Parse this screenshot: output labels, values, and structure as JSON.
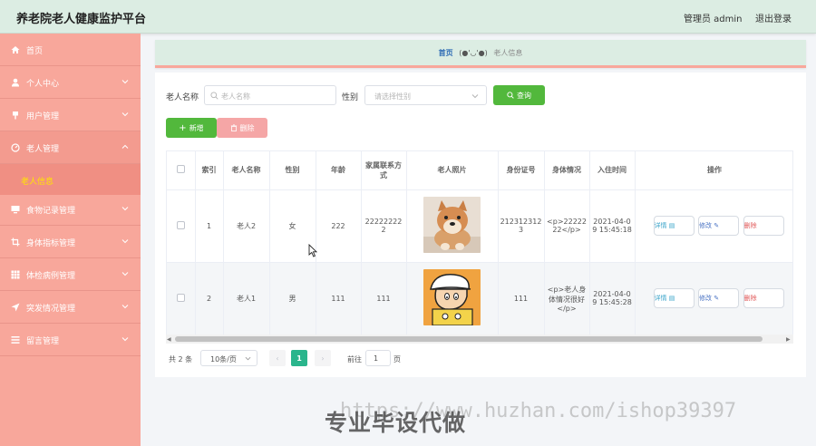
{
  "app": {
    "title": "养老院老人健康监护平台",
    "user_label": "管理员 admin",
    "logout_label": "退出登录"
  },
  "sidebar": {
    "items": [
      {
        "label": "首页",
        "icon": "home-icon"
      },
      {
        "label": "个人中心",
        "icon": "user-icon"
      },
      {
        "label": "用户管理",
        "icon": "pin-icon"
      },
      {
        "label": "老人管理",
        "icon": "dashboard-icon"
      },
      {
        "label": "食物记录管理",
        "icon": "monitor-icon"
      },
      {
        "label": "身体指标管理",
        "icon": "crop-icon"
      },
      {
        "label": "体检病例管理",
        "icon": "grid-icon"
      },
      {
        "label": "突发情况管理",
        "icon": "send-icon"
      },
      {
        "label": "留言管理",
        "icon": "list-icon"
      }
    ],
    "sub_item": "老人信息"
  },
  "breadcrumb": {
    "home": "首页",
    "face": "(●'◡'●)",
    "current": "老人信息"
  },
  "search": {
    "name_label": "老人名称",
    "name_placeholder": "老人名称",
    "gender_label": "性别",
    "gender_placeholder": "请选择性别",
    "query_label": "查询"
  },
  "actions": {
    "add_label": "新增",
    "delete_label": "删除"
  },
  "table": {
    "headers": [
      "索引",
      "老人名称",
      "性别",
      "年龄",
      "家属联系方式",
      "老人照片",
      "身份证号",
      "身体情况",
      "入住时间",
      "操作"
    ],
    "rows": [
      {
        "index": "1",
        "name": "老人2",
        "gender": "女",
        "age": "222",
        "contact": "222222222",
        "photo": "shiba-dog-photo",
        "id_number": "2123123123",
        "health": "<p>2222222</p>",
        "checkin": "2021-04-09 15:45:18"
      },
      {
        "index": "2",
        "name": "老人1",
        "gender": "男",
        "age": "111",
        "contact": "111",
        "photo": "cartoon-boy-photo",
        "id_number": "111",
        "health": "<p>老人身体情况很好</p>",
        "checkin": "2021-04-09 15:45:28"
      }
    ],
    "detail_label": "详情",
    "edit_label": "修改",
    "delete_label": "删除"
  },
  "pagination": {
    "total_text": "共 2 条",
    "page_size": "10条/页",
    "current_page": "1",
    "goto_label": "前往",
    "goto_value": "1",
    "page_suffix": "页"
  },
  "watermark": {
    "cn": "专业毕设代做",
    "url": "https://www.huzhan.com/ishop39397"
  },
  "colors": {
    "sidebar": "#f8a79b",
    "header": "#dcede3",
    "primary_green": "#52b83c",
    "active_page": "#2ab58c",
    "sub_item_text": "#ffe600"
  }
}
